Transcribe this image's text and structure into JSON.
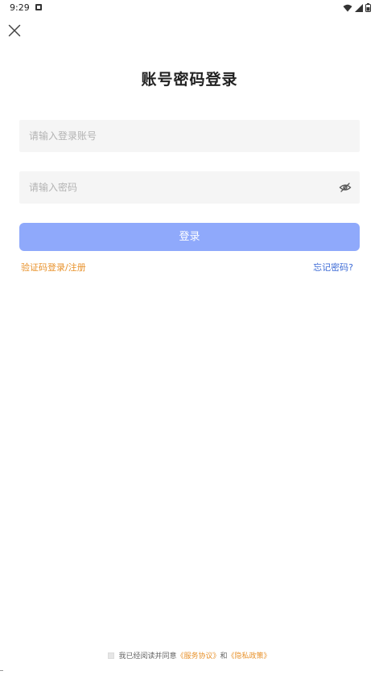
{
  "status_bar": {
    "time": "9:29",
    "icons": [
      "notification-a-icon",
      "wifi-icon",
      "signal-icon",
      "battery-icon"
    ]
  },
  "header": {
    "close_icon": "close-icon",
    "title": "账号密码登录"
  },
  "form": {
    "account_placeholder": "请输入登录账号",
    "account_value": "",
    "password_placeholder": "请输入密码",
    "password_value": "",
    "password_toggle_icon": "eye-hidden-icon",
    "login_label": "登录"
  },
  "links": {
    "sms_login": "验证码登录/注册",
    "forgot_password": "忘记密码?"
  },
  "agreement": {
    "checked": false,
    "prefix": "我已经阅读并同意",
    "terms": "《服务协议》",
    "conjunction": "和",
    "privacy": "《隐私政策》"
  },
  "colors": {
    "primary_button": "#8fa9fb",
    "accent_orange": "#e8922c",
    "accent_blue": "#3d6bd6",
    "input_bg": "#f5f5f5"
  }
}
